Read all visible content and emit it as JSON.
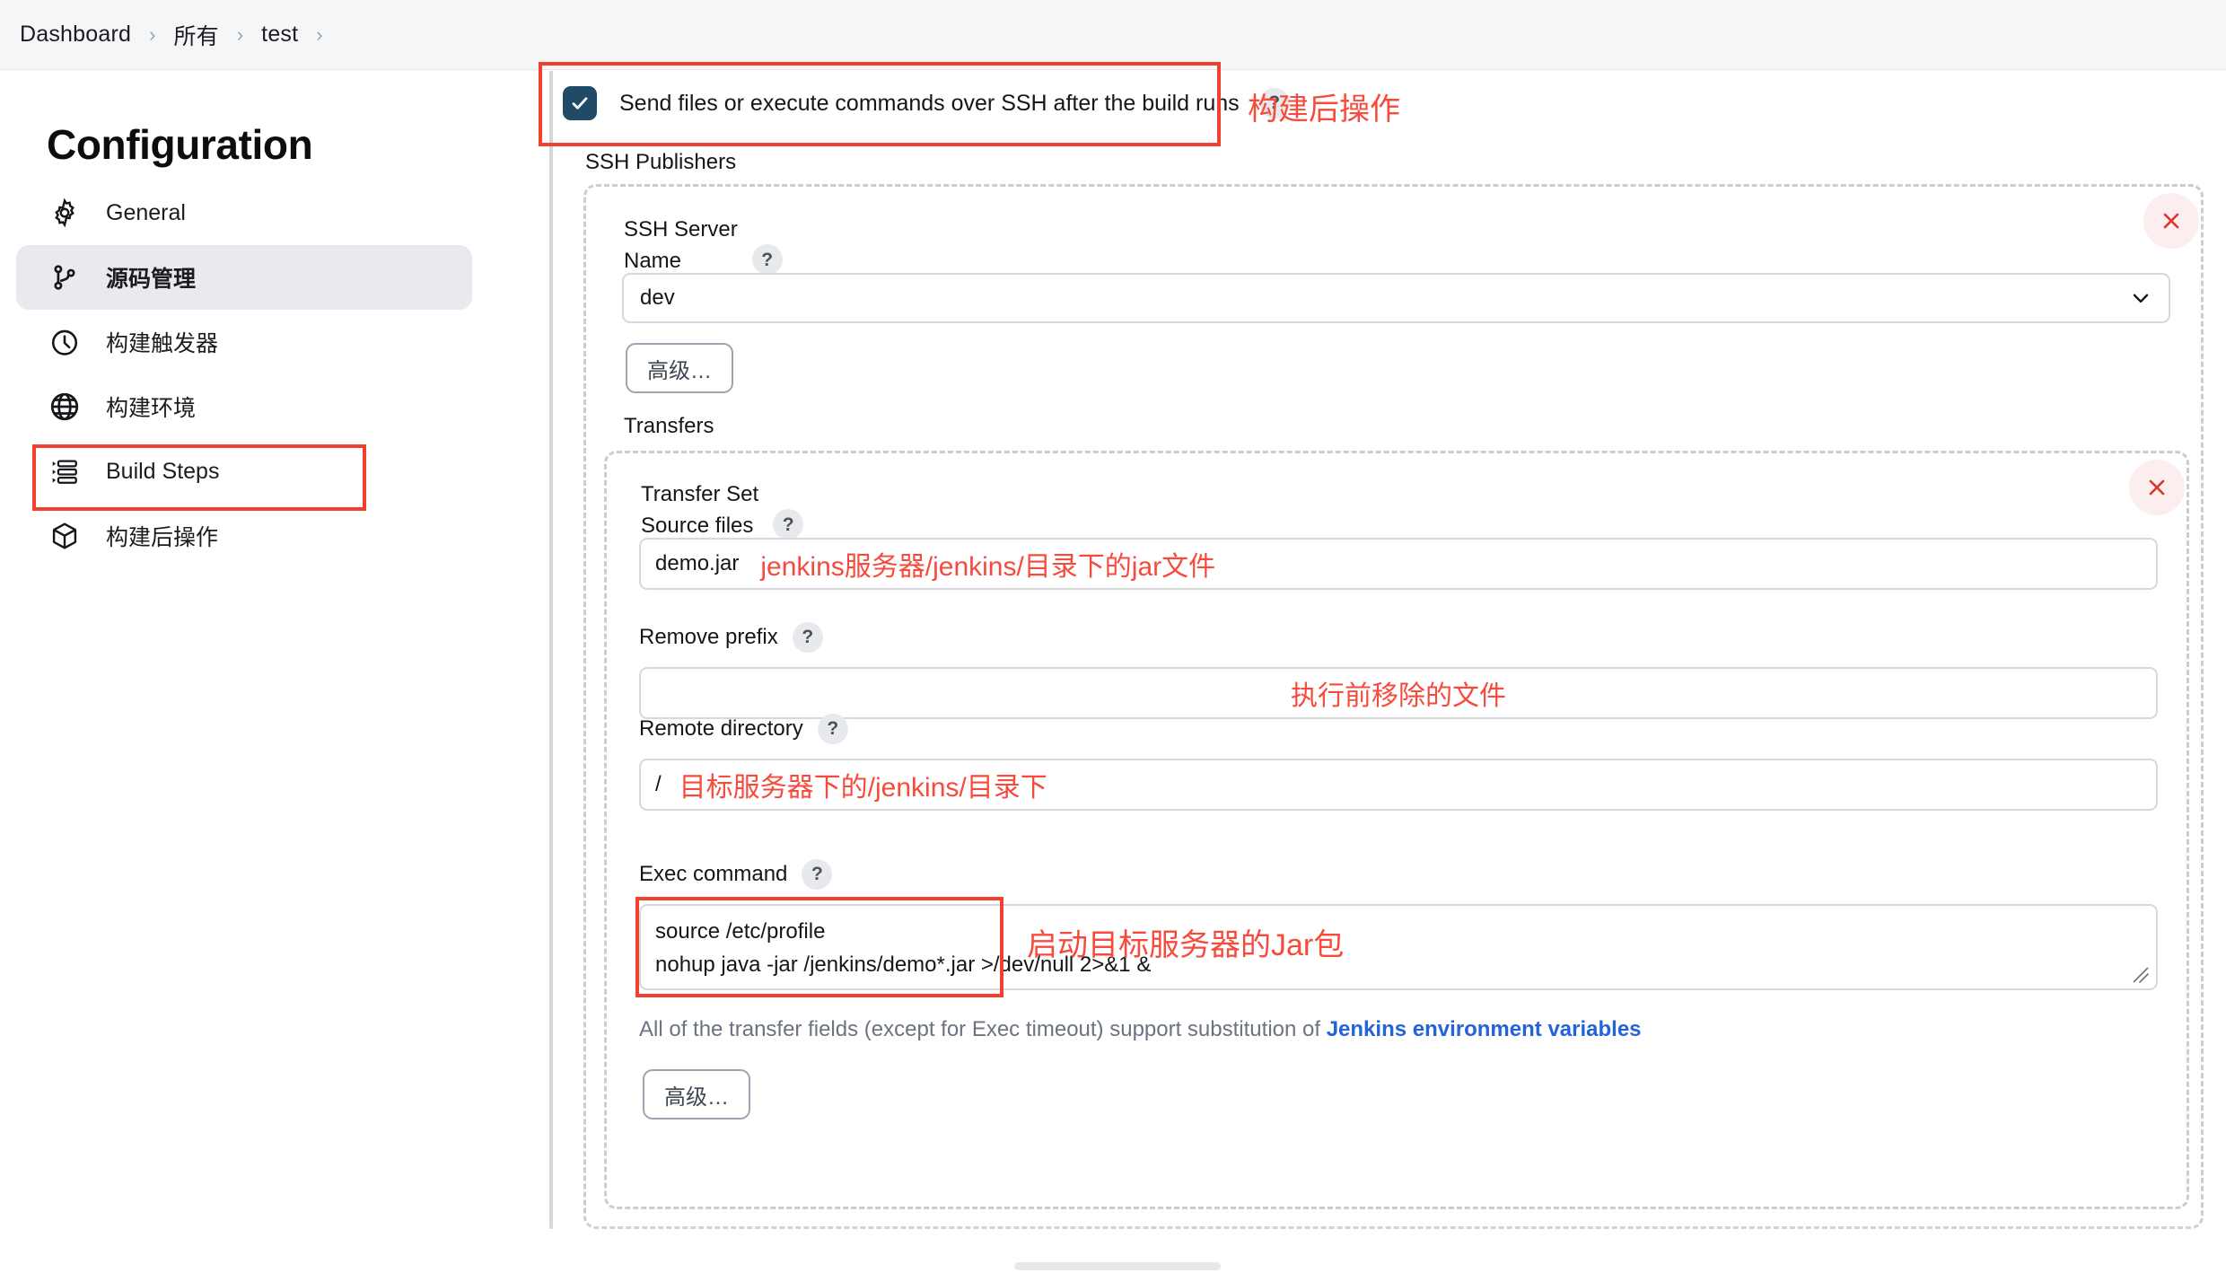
{
  "breadcrumb": {
    "items": [
      "Dashboard",
      "所有",
      "test"
    ],
    "separator": "›"
  },
  "sidebar": {
    "title": "Configuration",
    "items": [
      {
        "label": "General",
        "icon": "gear-icon",
        "active": false
      },
      {
        "label": "源码管理",
        "icon": "source-branch-icon",
        "active": true
      },
      {
        "label": "构建触发器",
        "icon": "clock-icon",
        "active": false
      },
      {
        "label": "构建环境",
        "icon": "globe-icon",
        "active": false
      },
      {
        "label": "Build Steps",
        "icon": "list-steps-icon",
        "active": false
      },
      {
        "label": "构建后操作",
        "icon": "package-icon",
        "active": false
      }
    ]
  },
  "main": {
    "checkbox": {
      "label": "Send files or execute commands over SSH after the build runs",
      "checked": true,
      "help": "?"
    },
    "ssh_publishers_label": "SSH Publishers",
    "ssh_server": {
      "label_line1": "SSH Server",
      "label_line2": "Name",
      "help": "?",
      "selected": "dev",
      "advanced_label": "高级…"
    },
    "transfers_label": "Transfers",
    "transfer_set": {
      "label_line1": "Transfer Set",
      "label_line2": "Source files",
      "help": "?",
      "source_files_value": "demo.jar",
      "remove_prefix_label": "Remove prefix",
      "remove_prefix_value": "",
      "remote_directory_label": "Remote directory",
      "remote_directory_value": "/",
      "exec_command_label": "Exec command",
      "exec_command_line1": "source /etc/profile",
      "exec_command_line2": "nohup java -jar /jenkins/demo*.jar >/dev/null 2>&1 &",
      "note_prefix": "All of the transfer fields (except for Exec timeout) support substitution of ",
      "note_link": "Jenkins environment variables",
      "advanced_label": "高级…"
    }
  },
  "annotations": {
    "postbuild": "构建后操作",
    "source_files": "jenkins服务器/jenkins/目录下的jar文件",
    "remove_prefix": "执行前移除的文件",
    "remote_directory": "目标服务器下的/jenkins/目录下",
    "exec_command": "启动目标服务器的Jar包"
  },
  "colors": {
    "annotation_red": "#f64b3c",
    "highlight_box": "#f2402f",
    "checkbox_fill": "#1f4b66",
    "link_blue": "#2563d9"
  }
}
